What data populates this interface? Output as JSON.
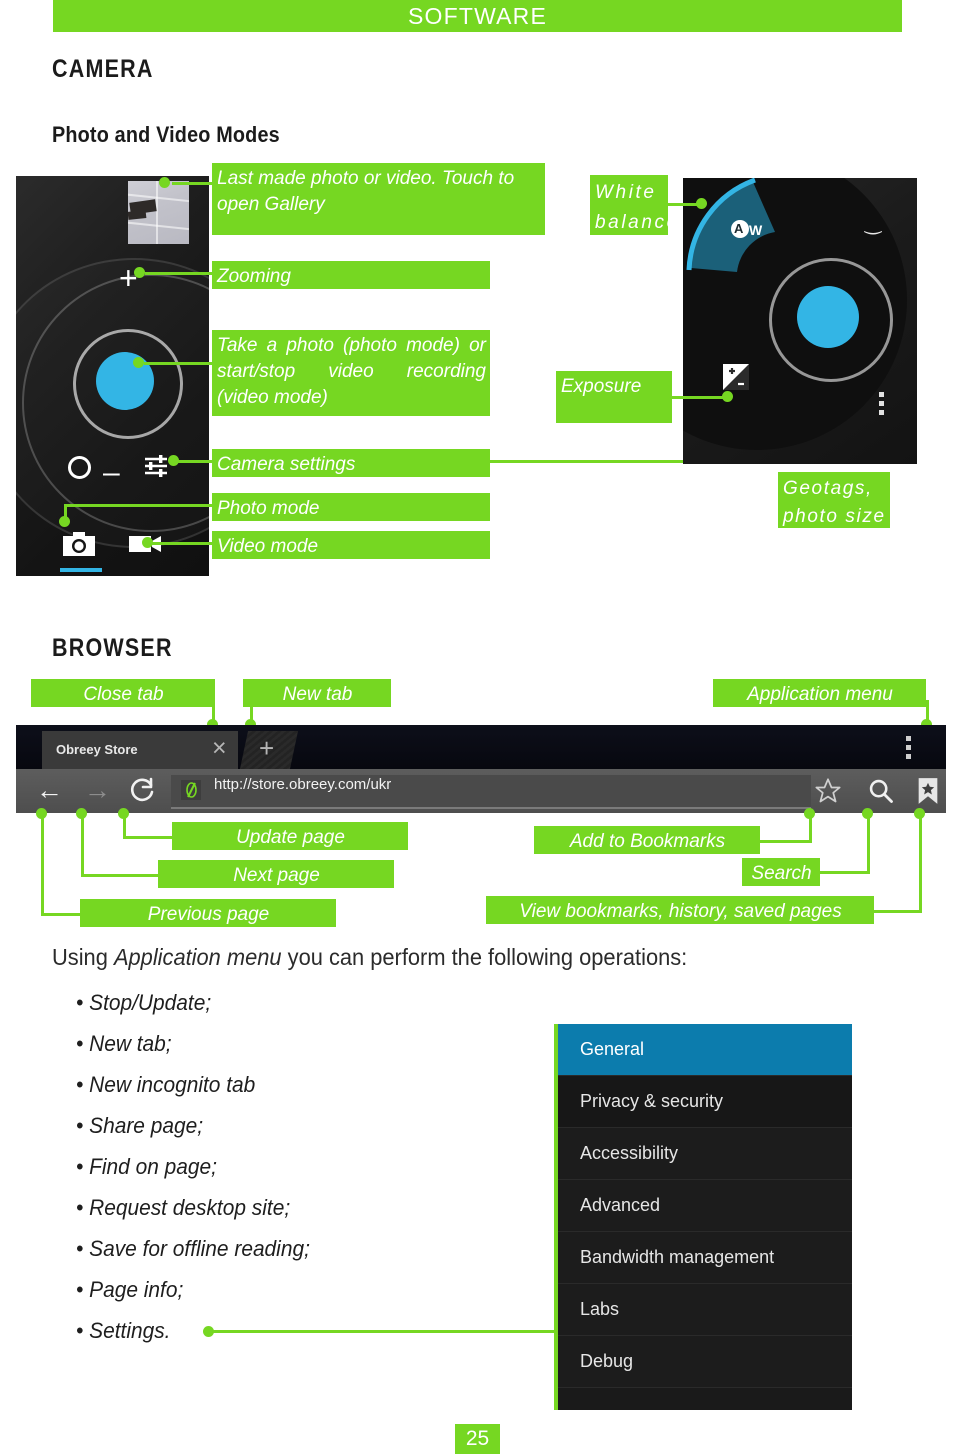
{
  "header": {
    "title": "SOFTWARE"
  },
  "sections": {
    "camera": {
      "heading": "CAMERA",
      "sub_heading": "Photo and Video Modes"
    },
    "browser": {
      "heading": "BROWSER"
    }
  },
  "camera_left_labels": {
    "gallery": "Last made photo or video. Touch to open Gallery",
    "zooming": "Zooming",
    "shutter": "Take a photo (photo mode) or start/stop video recording (video mode)",
    "settings": "Camera settings",
    "photo_mode": "Photo mode",
    "video_mode": "Video mode"
  },
  "camera_right_labels": {
    "white_balance": "White\nbalance",
    "exposure": "Exposure",
    "geotags": "Geotags,\nphoto size"
  },
  "camera_right_icons": {
    "white_balance_glyph": "AW",
    "exposure_glyph": "exposure-compensation-icon",
    "overflow_glyph": "overflow-menu-icon"
  },
  "browser_labels": {
    "close_tab": "Close tab",
    "new_tab": "New tab",
    "application_menu": "Application menu",
    "update_page": "Update page",
    "next_page": "Next page",
    "previous_page": "Previous page",
    "add_to_bookmarks": "Add to Bookmarks",
    "search": "Search",
    "view_bookmarks": "View bookmarks, history, saved  pages"
  },
  "browser_ui": {
    "tab_title": "Obreey Store",
    "close_tab_glyph": "×",
    "new_tab_glyph": "+",
    "back_glyph": "←",
    "forward_glyph": "→",
    "reload_glyph": "C",
    "url": "http://store.obreey.com/ukr",
    "star_glyph": "☆",
    "search_glyph": "search-icon",
    "bookmarks_glyph": "bookmark-icon",
    "menu_glyph": "overflow-menu-icon"
  },
  "intro": {
    "before": "Using ",
    "emphasis": "Application menu",
    "after": " you can perform the following operations:"
  },
  "menu_operations": [
    "Stop/Update;",
    "New tab;",
    "New incognito tab",
    "Share page;",
    "Find on page;",
    "Request desktop site;",
    "Save for offline reading;",
    "Page info;",
    "Settings."
  ],
  "settings_menu": {
    "items": [
      {
        "label": "General",
        "selected": true
      },
      {
        "label": "Privacy & security",
        "selected": false
      },
      {
        "label": "Accessibility",
        "selected": false
      },
      {
        "label": "Advanced",
        "selected": false
      },
      {
        "label": "Bandwidth management",
        "selected": false
      },
      {
        "label": "Labs",
        "selected": false
      },
      {
        "label": "Debug",
        "selected": false
      }
    ]
  },
  "page_number": "25",
  "colors": {
    "accent_green": "#76d722",
    "shutter_blue": "#33b5e5",
    "settings_selected": "#0c7cad"
  }
}
